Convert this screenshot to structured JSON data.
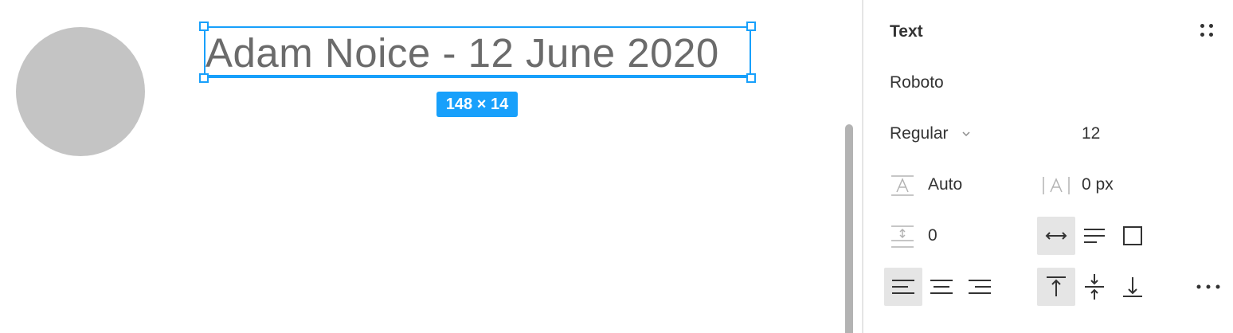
{
  "canvas": {
    "selected_text": "Adam Noice - 12 June 2020",
    "size_badge": "148 × 14",
    "colors": {
      "selection": "#18a0fb",
      "avatar": "#c4c4c4",
      "text": "#6b6b6b"
    }
  },
  "panel": {
    "title": "Text",
    "styles_icon": "grid-4-dots-icon",
    "font_family": "Roboto",
    "font_weight": "Regular",
    "font_size": "12",
    "line_height": "Auto",
    "letter_spacing": "0 px",
    "paragraph_spacing": "0",
    "resize_options": [
      {
        "name": "auto-width",
        "icon": "auto-width-icon",
        "active": true
      },
      {
        "name": "auto-height",
        "icon": "auto-height-icon",
        "active": false
      },
      {
        "name": "fixed-size",
        "icon": "fixed-size-icon",
        "active": false
      }
    ],
    "align_horizontal": [
      {
        "name": "align-left",
        "icon": "align-left-icon",
        "active": true
      },
      {
        "name": "align-center",
        "icon": "align-center-icon",
        "active": false
      },
      {
        "name": "align-right",
        "icon": "align-right-icon",
        "active": false
      }
    ],
    "align_vertical": [
      {
        "name": "align-top",
        "icon": "align-top-icon",
        "active": true
      },
      {
        "name": "align-middle",
        "icon": "align-middle-icon",
        "active": false
      },
      {
        "name": "align-bottom",
        "icon": "align-bottom-icon",
        "active": false
      }
    ],
    "more_icon": "more-horizontal-icon"
  }
}
